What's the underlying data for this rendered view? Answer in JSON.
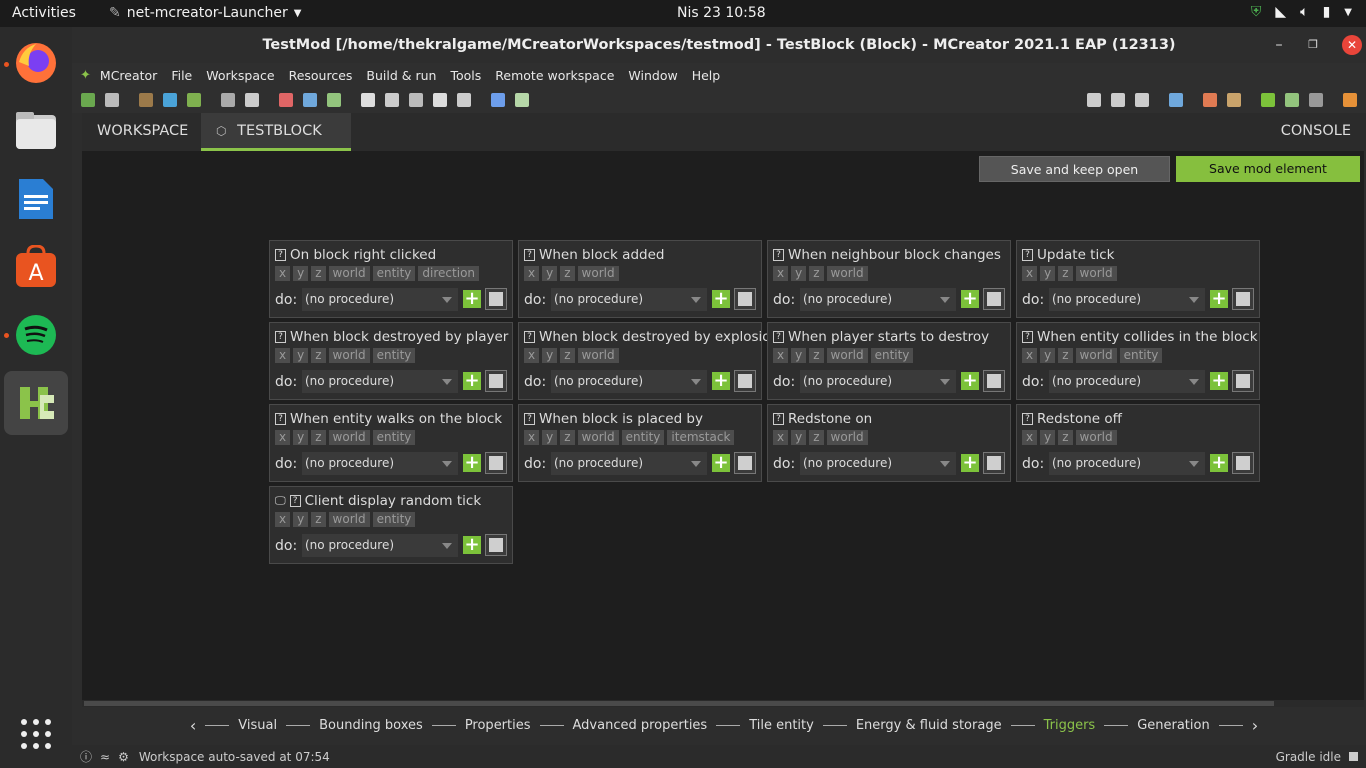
{
  "topbar": {
    "activities": "Activities",
    "app_name": "net-mcreator-Launcher",
    "clock": "Nis 23  10:58"
  },
  "window": {
    "title": "TestMod [/home/thekralgame/MCreatorWorkspaces/testmod] - TestBlock (Block) - MCreator 2021.1 EAP (12313)"
  },
  "menu": [
    "MCreator",
    "File",
    "Workspace",
    "Resources",
    "Build & run",
    "Tools",
    "Remote workspace",
    "Window",
    "Help"
  ],
  "tabs": {
    "workspace": "WORKSPACE",
    "testblock": "TESTBLOCK",
    "console": "CONSOLE"
  },
  "buttons": {
    "save_open": "Save and keep open",
    "save": "Save mod element"
  },
  "do_label": "do:",
  "procedure_default": "(no procedure)",
  "triggers": [
    {
      "title": "On block right clicked",
      "params": [
        "x",
        "y",
        "z",
        "world",
        "entity",
        "direction"
      ]
    },
    {
      "title": "When block added",
      "params": [
        "x",
        "y",
        "z",
        "world"
      ]
    },
    {
      "title": "When neighbour block changes",
      "params": [
        "x",
        "y",
        "z",
        "world"
      ]
    },
    {
      "title": "Update tick",
      "params": [
        "x",
        "y",
        "z",
        "world"
      ]
    },
    {
      "title": "When block destroyed by player",
      "params": [
        "x",
        "y",
        "z",
        "world",
        "entity"
      ]
    },
    {
      "title": "When block destroyed by explosion",
      "params": [
        "x",
        "y",
        "z",
        "world"
      ]
    },
    {
      "title": "When player starts to destroy",
      "params": [
        "x",
        "y",
        "z",
        "world",
        "entity"
      ]
    },
    {
      "title": "When entity collides in the block",
      "params": [
        "x",
        "y",
        "z",
        "world",
        "entity"
      ]
    },
    {
      "title": "When entity walks on the block",
      "params": [
        "x",
        "y",
        "z",
        "world",
        "entity"
      ]
    },
    {
      "title": "When block is placed by",
      "params": [
        "x",
        "y",
        "z",
        "world",
        "entity",
        "itemstack"
      ]
    },
    {
      "title": "Redstone on",
      "params": [
        "x",
        "y",
        "z",
        "world"
      ]
    },
    {
      "title": "Redstone off",
      "params": [
        "x",
        "y",
        "z",
        "world"
      ]
    },
    {
      "title": "Client display random tick",
      "params": [
        "x",
        "y",
        "z",
        "world",
        "entity"
      ]
    }
  ],
  "steps": [
    "Visual",
    "Bounding boxes",
    "Properties",
    "Advanced properties",
    "Tile entity",
    "Energy & fluid storage",
    "Triggers",
    "Generation"
  ],
  "current_step": "Triggers",
  "status": {
    "message": "Workspace auto-saved at 07:54",
    "gradle": "Gradle idle"
  },
  "colors": {
    "accent": "#8bc34a",
    "add": "#7cc23a"
  }
}
